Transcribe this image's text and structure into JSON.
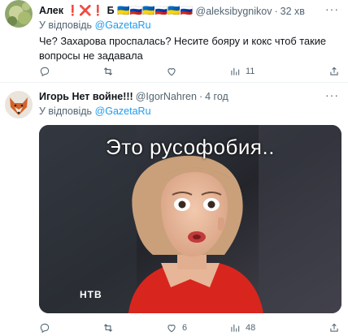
{
  "tweets": [
    {
      "author_name": "Алек ❗❌❗ Б 🇺🇦🇷🇺🇺🇦🇷🇺🇺🇦🇷🇺",
      "handle": "@aleksibygnikov",
      "separator": "·",
      "time": "32 хв",
      "reply_prefix": "У відповідь",
      "reply_to": "@GazetaRu",
      "text": "Че? Захарова проспалась? Несите бояру и кокс чтоб такие вопросы не задавала",
      "stats": {
        "replies": "",
        "retweets": "",
        "likes": "",
        "views": "11"
      }
    },
    {
      "author_name": "Игорь Нет войне!!!",
      "handle": "@IgorNahren",
      "separator": "·",
      "time": "4 год",
      "reply_prefix": "У відповідь",
      "reply_to": "@GazetaRu",
      "media_caption": "Это русофобия..",
      "media_logo": "НТВ",
      "stats": {
        "replies": "",
        "retweets": "",
        "likes": "6",
        "views": "48"
      }
    }
  ],
  "icons": {
    "more": "more-icon",
    "reply": "reply-icon",
    "retweet": "retweet-icon",
    "like": "like-icon",
    "views": "views-icon",
    "share": "share-icon"
  }
}
